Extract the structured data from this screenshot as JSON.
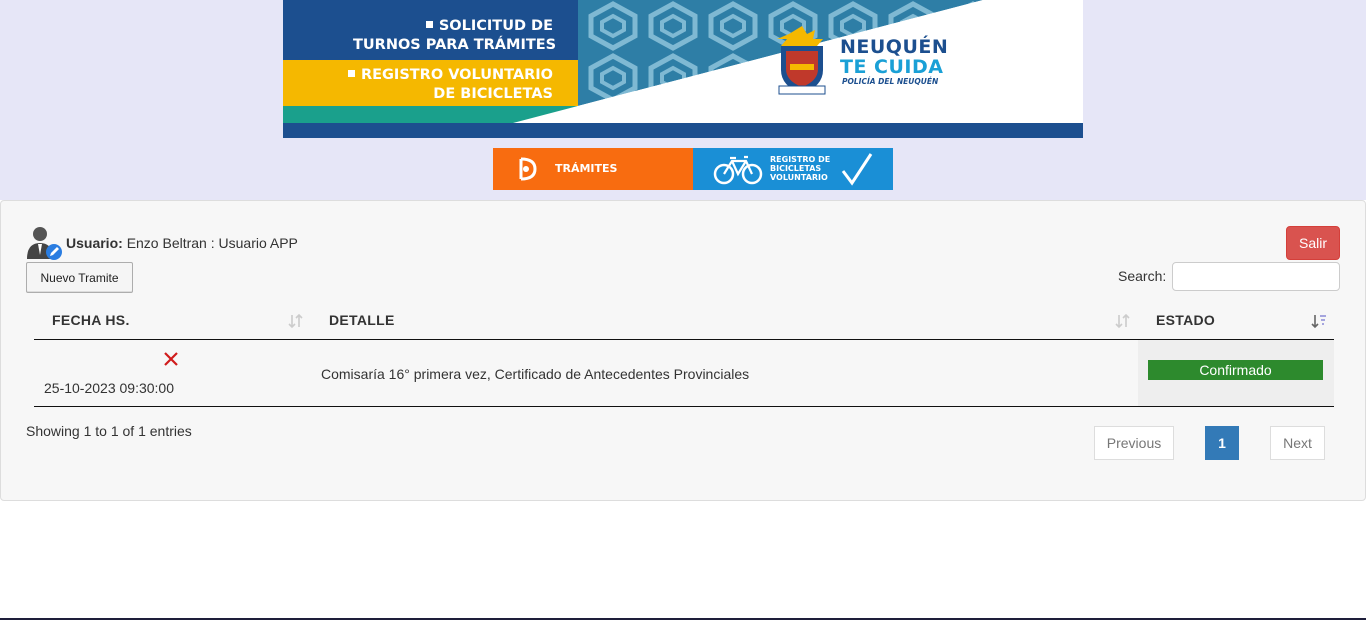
{
  "banner": {
    "line1": "SOLICITUD DE",
    "line2": "TURNOS PARA TRÁMITES",
    "line3": "REGISTRO VOLUNTARIO",
    "line4": "DE BICICLETAS",
    "logo_line1": "NEUQUÉN",
    "logo_line2": "TE CUIDA",
    "logo_line3": "POLICÍA DEL NEUQUÉN",
    "colors": {
      "navy": "#1c4f8f",
      "yellow": "#f5b800",
      "teal": "#1aa0a0",
      "blue": "#1aa0d6"
    }
  },
  "quick_nav": {
    "tramites_label": "TRÁMITES",
    "bicicletas_label": "REGISTRO DE\nBICICLETAS\nVOLUNTARIO",
    "tramites_color": "#f86c10",
    "bicicletas_color": "#1a8fd6"
  },
  "user": {
    "label": "Usuario:",
    "value": "Enzo Beltran : Usuario APP",
    "icon": "user-edit-icon"
  },
  "actions": {
    "nuevo_label": "Nuevo Tramite",
    "salir_label": "Salir"
  },
  "search": {
    "label": "Search:",
    "value": ""
  },
  "table": {
    "columns": [
      "FECHA HS.",
      "DETALLE",
      "ESTADO"
    ],
    "rows": [
      {
        "fecha": "25-10-2023 09:30:00",
        "detalle": "Comisaría 16° primera vez, Certificado de Antecedentes Provinciales",
        "estado": "Confirmado",
        "cancel_icon": "close-icon"
      }
    ]
  },
  "footer": {
    "info": "Showing 1 to 1 of 1 entries",
    "prev_label": "Previous",
    "page": "1",
    "next_label": "Next"
  }
}
